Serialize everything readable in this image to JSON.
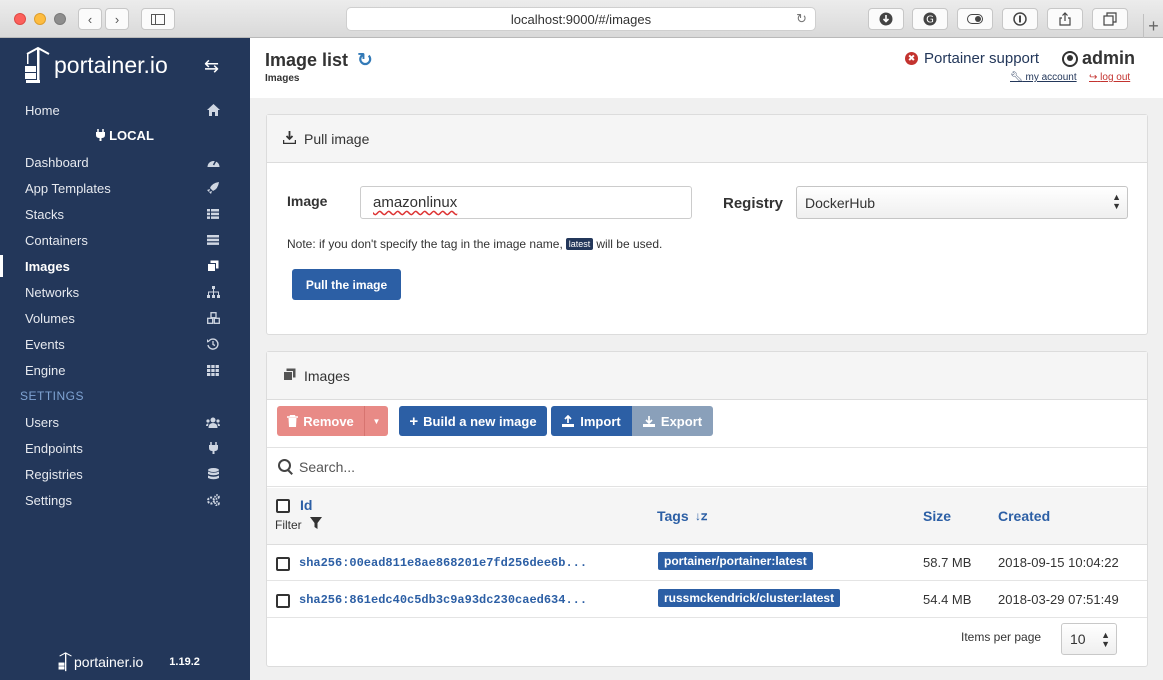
{
  "browser": {
    "url": "localhost:9000/#/images",
    "plus_label": "+"
  },
  "sidebar": {
    "logo_text": "portainer.io",
    "endpoint": "LOCAL",
    "home_label": "Home",
    "items": [
      {
        "label": "Dashboard",
        "icon": "tachometer-icon"
      },
      {
        "label": "App Templates",
        "icon": "rocket-icon"
      },
      {
        "label": "Stacks",
        "icon": "th-list-icon"
      },
      {
        "label": "Containers",
        "icon": "server-icon"
      },
      {
        "label": "Images",
        "icon": "clone-icon"
      },
      {
        "label": "Networks",
        "icon": "sitemap-icon"
      },
      {
        "label": "Volumes",
        "icon": "cubes-icon"
      },
      {
        "label": "Events",
        "icon": "history-icon"
      },
      {
        "label": "Engine",
        "icon": "th-icon"
      }
    ],
    "active_item": "Images",
    "settings_header": "SETTINGS",
    "settings_items": [
      {
        "label": "Users",
        "icon": "users-icon"
      },
      {
        "label": "Endpoints",
        "icon": "plug-icon"
      },
      {
        "label": "Registries",
        "icon": "database-icon"
      },
      {
        "label": "Settings",
        "icon": "cogs-icon"
      }
    ],
    "footer_logo": "portainer.io",
    "version": "1.19.2"
  },
  "header": {
    "title": "Image list",
    "breadcrumb": "Images",
    "support": "Portainer support",
    "user": "admin",
    "my_account": "my account",
    "log_out": "log out"
  },
  "pull": {
    "title": "Pull image",
    "image_label": "Image",
    "image_value": "amazonlinux",
    "registry_label": "Registry",
    "registry_value": "DockerHub",
    "note_before": "Note: if you don't specify the tag in the image name,",
    "note_tag": "latest",
    "note_after": "will be used.",
    "button": "Pull the image"
  },
  "images": {
    "title": "Images",
    "remove": "Remove",
    "build": "Build a new image",
    "import": "Import",
    "export": "Export",
    "search_placeholder": "Search...",
    "columns": {
      "id": "Id",
      "filter": "Filter",
      "tags": "Tags",
      "size": "Size",
      "created": "Created"
    },
    "rows": [
      {
        "id": "sha256:00ead811e8ae868201e7fd256dee6b...",
        "tag": "portainer/portainer:latest",
        "size": "58.7 MB",
        "created": "2018-09-15 10:04:22"
      },
      {
        "id": "sha256:861edc40c5db3c9a93dc230caed634...",
        "tag": "russmckendrick/cluster:latest",
        "size": "54.4 MB",
        "created": "2018-03-29 07:51:49"
      }
    ],
    "items_per_page_label": "Items per page",
    "items_per_page_value": "10"
  },
  "colors": {
    "sidebar": "#23375a",
    "primary": "#2c5fa5",
    "danger": "#e88a86",
    "disabled": "#8aa0ba"
  }
}
